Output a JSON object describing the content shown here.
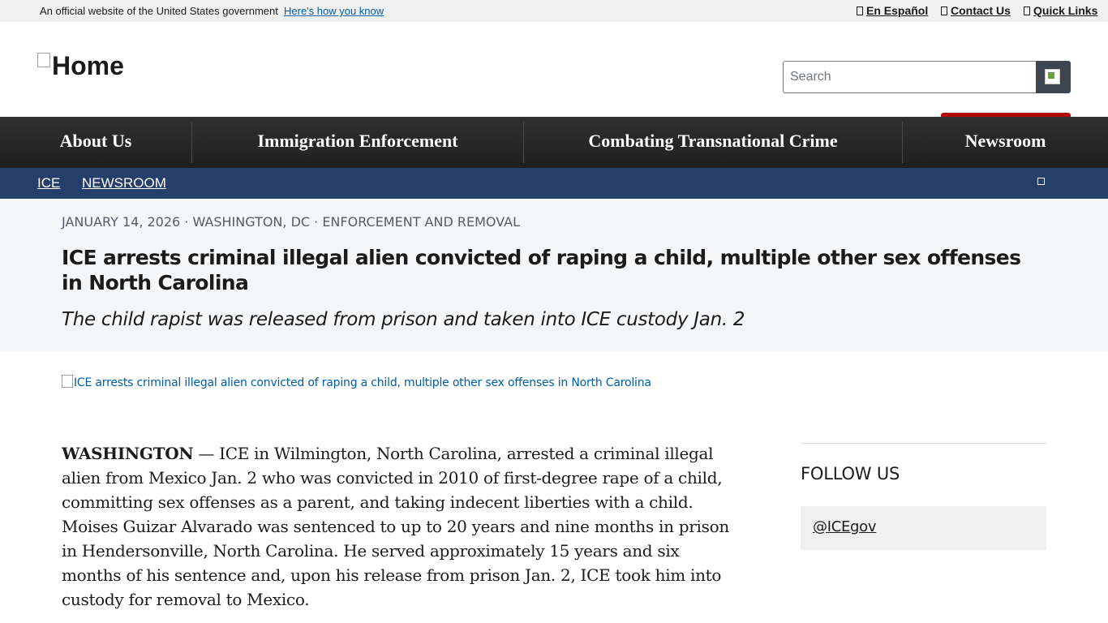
{
  "gov_banner": {
    "official_text": "An official website of the United States government",
    "how_link": "Here's how you know",
    "links": [
      "En Español",
      "Contact Us",
      "Quick Links"
    ]
  },
  "header": {
    "logo_alt": "Home",
    "search_placeholder": "Search"
  },
  "nav": {
    "items": [
      "About Us",
      "Immigration Enforcement",
      "Combating Transnational Crime",
      "Newsroom"
    ]
  },
  "breadcrumb": [
    "ICE",
    "NEWSROOM"
  ],
  "article": {
    "meta": "JANUARY 14, 2026 · WASHINGTON, DC · ENFORCEMENT AND REMOVAL",
    "title": "ICE arrests criminal illegal alien convicted of raping a child, multiple other sex offenses in North Carolina",
    "subtitle": "The child rapist was released from prison and taken into ICE custody Jan. 2",
    "image_alt": "ICE arrests criminal illegal alien convicted of raping a child, multiple other sex offenses in North Carolina",
    "dateline": "WASHINGTON",
    "body": " — ICE in Wilmington, North Carolina, arrested a criminal illegal alien from Mexico Jan. 2 who was convicted in 2010 of first-degree rape of a child, committing sex offenses as a parent, and taking indecent liberties with a child. Moises Guizar Alvarado was sentenced to up to 20 years and nine months in prison in Hendersonville, North Carolina. He served approximately 15 years and six months of his sentence and, upon his release from prison Jan. 2, ICE took him into custody for removal to Mexico."
  },
  "sidebar": {
    "follow_heading": "FOLLOW US",
    "social_handle": "@ICEgov"
  }
}
